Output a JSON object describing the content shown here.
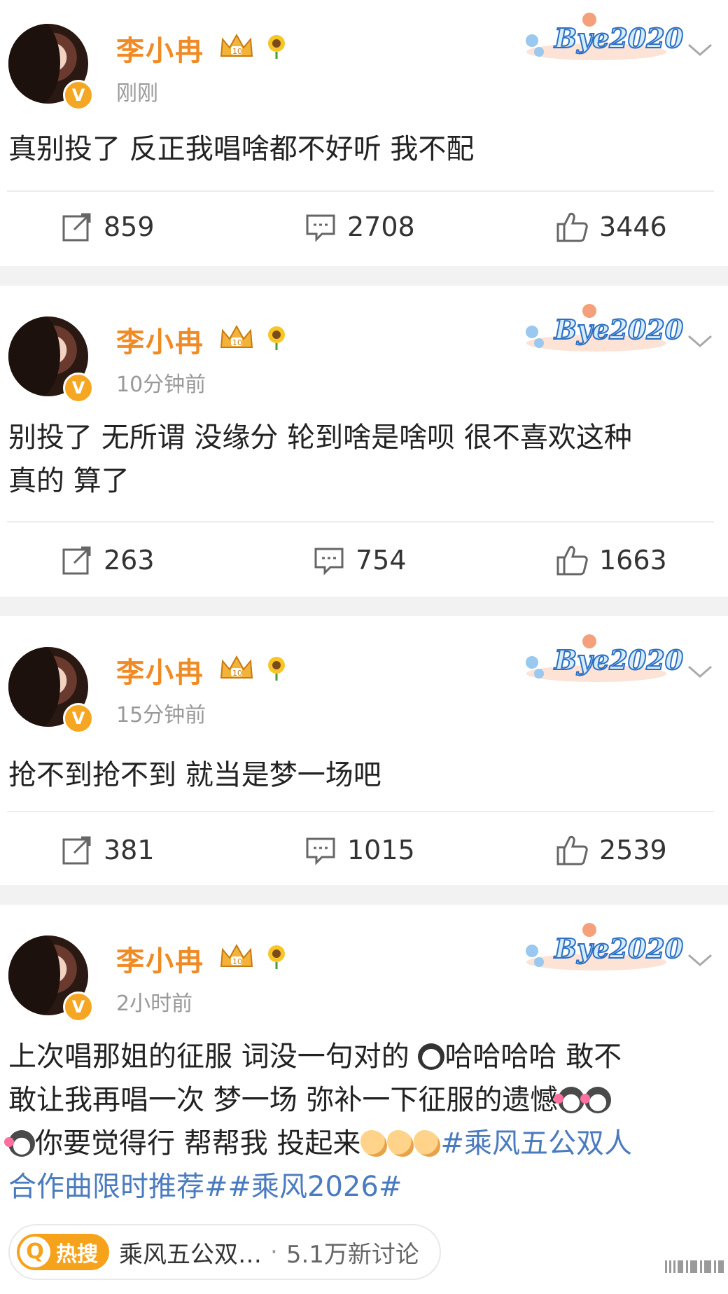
{
  "user": {
    "name": "李小冉",
    "verified_badge": "V",
    "crown_level": "10"
  },
  "sticker_text": "Bye2020",
  "posts": [
    {
      "time": "刚刚",
      "content": "真别投了 反正我唱啥都不好听 我不配",
      "repost": "859",
      "comment": "2708",
      "like": "3446"
    },
    {
      "time": "10分钟前",
      "content_line1": "别投了 无所谓 没缘分 轮到啥是啥呗 很不喜欢这种",
      "content_line2": "真的  算了",
      "repost": "263",
      "comment": "754",
      "like": "1663"
    },
    {
      "time": "15分钟前",
      "content": "抢不到抢不到 就当是梦一场吧",
      "repost": "381",
      "comment": "1015",
      "like": "2539"
    },
    {
      "time": "2小时前",
      "line1_a": "上次唱那姐的征服 词没一句对的 ",
      "line1_b": "哈哈哈哈 敢不",
      "line2": "敢让我再唱一次 梦一场 弥补一下征服的遗憾",
      "line3_a": "你要觉得行 帮帮我 投起来",
      "line3_tag": "#乘风五公双人",
      "line4_tag": "合作曲限时推荐##乘风2026#"
    }
  ],
  "hot": {
    "logo": "热搜",
    "title": "乘风五公双…",
    "dot": "·",
    "count": "5.1万新讨论"
  },
  "icons": {
    "repost": "repost-icon",
    "comment": "comment-icon",
    "like": "like-icon"
  },
  "colors": {
    "name": "#f08a24",
    "hashtag": "#4b7bbf",
    "badge": "#f5a623"
  }
}
